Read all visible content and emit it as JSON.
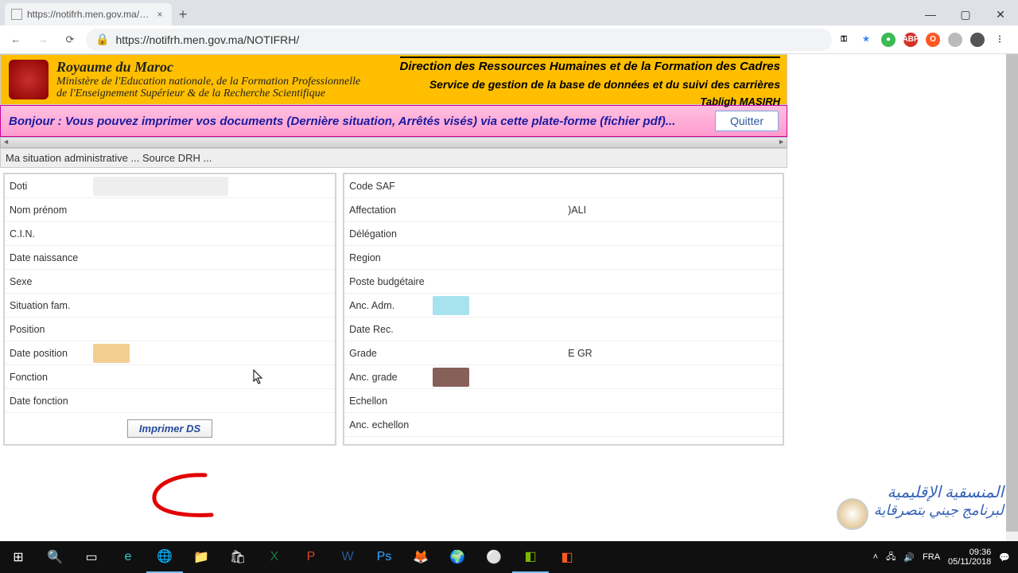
{
  "browser": {
    "tab_title": "https://notifrh.men.gov.ma/NOTI",
    "url": "https://notifrh.men.gov.ma/NOTIFRH/"
  },
  "header": {
    "kingdom": "Royaume du Maroc",
    "ministry_line1": "Ministère de l'Education nationale, de la Formation Professionnelle",
    "ministry_line2": "de l'Enseignement Supérieur & de la Recherche Scientifique",
    "dir_line1": "Direction des Ressources Humaines et de la Formation des Cadres",
    "dir_line2": "Service de gestion de la base de données et du suivi des carrières",
    "app_name": "Tabligh MASIRH"
  },
  "notice": {
    "text": "Bonjour : Vous pouvez imprimer vos documents (Dernière situation, Arrêtés visés) via cette plate-forme (fichier pdf)...",
    "quit": "Quitter"
  },
  "subheader": "Ma situation administrative ... Source DRH ...",
  "left_fields": {
    "doti": "Doti",
    "nom": "Nom prénom",
    "cin": "C.I.N.",
    "dob": "Date naissance",
    "sexe": "Sexe",
    "sitfam": "Situation fam.",
    "position": "Position",
    "datepos": "Date position",
    "fonction": "Fonction",
    "datefonc": "Date fonction"
  },
  "right_fields": {
    "codesaf": "Code SAF",
    "affect": "Affectation",
    "affect_val": ")ALI",
    "deleg": "Délégation",
    "region": "Region",
    "poste": "Poste budgétaire",
    "ancadm": "Anc. Adm.",
    "daterec": "Date Rec.",
    "grade": "Grade",
    "grade_val": "E GR",
    "ancgrade": "Anc. grade",
    "echelon": "Echellon",
    "ancech": "Anc. echellon"
  },
  "buttons": {
    "print_ds": "Imprimer DS"
  },
  "watermark": {
    "line1": "المنسقية الإقليمية",
    "line2": "لبرنامج جيني بتصرقاية"
  },
  "taskbar": {
    "lang": "FRA",
    "time": "09:36",
    "date": "05/11/2018"
  }
}
